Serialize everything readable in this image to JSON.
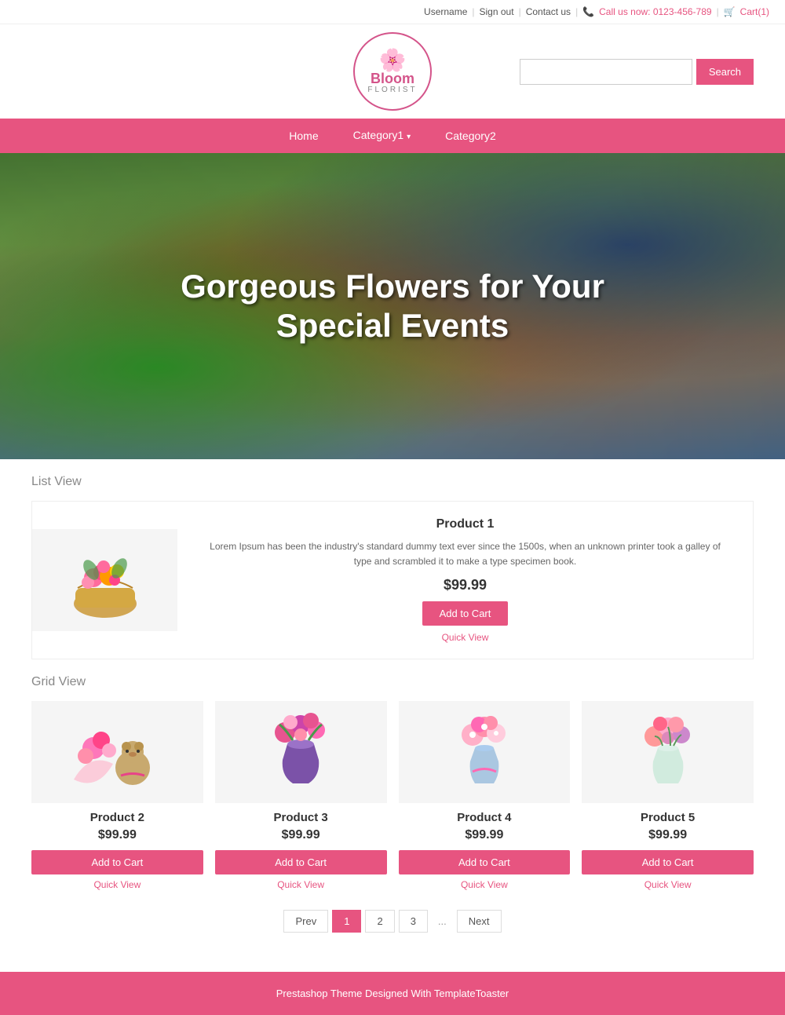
{
  "topbar": {
    "username": "Username",
    "signout": "Sign out",
    "contact": "Contact us",
    "phone_icon": "📞",
    "phone": "Call us now: 0123-456-789",
    "cart_icon": "🛒",
    "cart": "Cart(1)"
  },
  "logo": {
    "flowers": "🌸🌺🌿",
    "name": "Bloom",
    "sub": "FLORIST"
  },
  "search": {
    "placeholder": "",
    "button": "Search"
  },
  "nav": {
    "home": "Home",
    "cat1": "Category1",
    "cat2": "Category2"
  },
  "hero": {
    "line1": "Gorgeous Flowers for Your",
    "line2": "Special Events"
  },
  "list_label": "List View",
  "grid_label": "Grid View",
  "product1": {
    "name": "Product 1",
    "desc": "Lorem Ipsum has been the industry's standard dummy text ever since the 1500s, when an unknown printer took a galley of type and scrambled it to make a type specimen book.",
    "price": "$99.99",
    "add_cart": "Add to Cart",
    "quick_view": "Quick View",
    "emoji": "🌸🧺"
  },
  "grid_products": [
    {
      "name": "Product 2",
      "price": "$99.99",
      "add_cart": "Add to Cart",
      "quick_view": "Quick View",
      "emoji": "🌹🧸"
    },
    {
      "name": "Product 3",
      "price": "$99.99",
      "add_cart": "Add to Cart",
      "quick_view": "Quick View",
      "emoji": "💐"
    },
    {
      "name": "Product 4",
      "price": "$99.99",
      "add_cart": "Add to Cart",
      "quick_view": "Quick View",
      "emoji": "🌷"
    },
    {
      "name": "Product 5",
      "price": "$99.99",
      "add_cart": "Add to Cart",
      "quick_view": "Quick View",
      "emoji": "🌸"
    }
  ],
  "pagination": {
    "prev": "Prev",
    "pages": [
      "1",
      "2",
      "3"
    ],
    "dots": "...",
    "next": "Next"
  },
  "footer": {
    "text": "Prestashop Theme Designed With TemplateToaster"
  }
}
